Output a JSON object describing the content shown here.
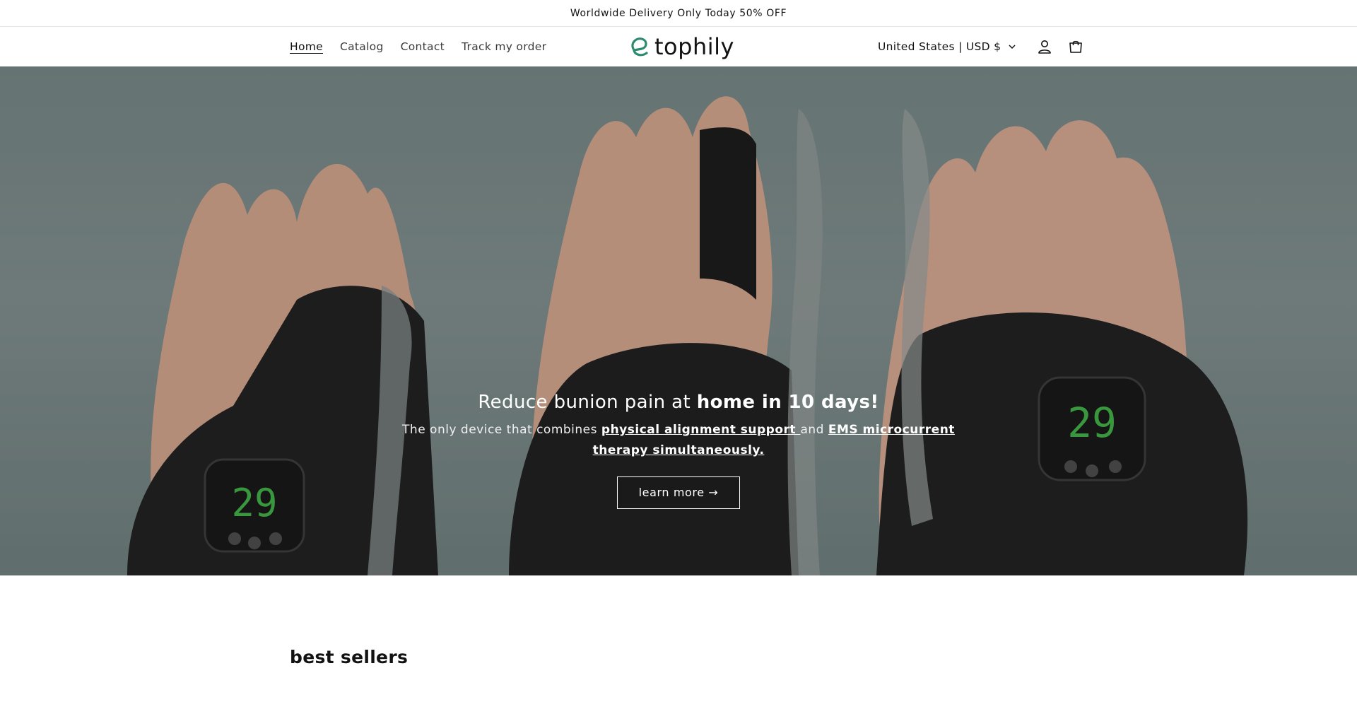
{
  "announcement": {
    "text": "Worldwide Delivery Only Today 50% OFF"
  },
  "nav": {
    "items": [
      {
        "label": "Home",
        "active": true
      },
      {
        "label": "Catalog"
      },
      {
        "label": "Contact"
      },
      {
        "label": "Track my order"
      }
    ]
  },
  "brand": {
    "name": "tophily",
    "accent": "#2c8a6e"
  },
  "header": {
    "country": "United States | USD $",
    "icons": [
      "account-icon",
      "cart-icon"
    ]
  },
  "hero": {
    "title_prefix": "Reduce bunion pain at ",
    "title_bold": "home in 10 days!",
    "subtitle_prefix": "The only device that combines ",
    "link1": "physical alignment support ",
    "subtitle_mid": "and ",
    "link2": "EMS microcurrent therapy simultaneously.",
    "button_label": "learn more →",
    "device_display": "29"
  },
  "section": {
    "title": "best sellers"
  }
}
